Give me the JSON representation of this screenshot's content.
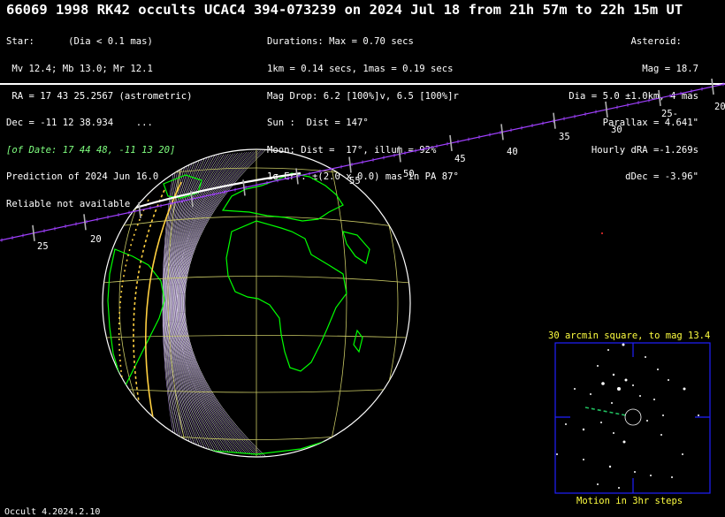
{
  "title": "66069 1998 RK42 occults UCAC4 394-073239 on 2024 Jul 18 from 21h 57m to 22h 15m UT",
  "star_info": [
    "Star:      (Dia < 0.1 mas)",
    " Mv 12.4; Mb 13.0; Mr 12.1",
    " RA = 17 43 25.2567 (astrometric)",
    "Dec = -11 12 38.934    ...",
    "[of Date: 17 44 48, -11 13 20]",
    "Prediction of 2024 Jun 16.0",
    "Reliable not available"
  ],
  "event_info": [
    "Durations: Max = 0.70 secs",
    "1km = 0.14 secs, 1mas = 0.19 secs",
    "Mag Drop: 6.2 [100%]v, 6.5 [100%]r",
    "Sun :  Dist = 147°",
    "Moon: Dist =  17°, illum = 92%",
    "1σ Err: ±(2.0 x 0.0) mas in PA 87°"
  ],
  "asteroid_info": [
    "Asteroid:   ",
    "Mag = 18.7",
    "Dia = 5.0 ±1.0km, 4 mas",
    "Parallax = 4.641\"",
    "Hourly dRA =-1.269s",
    "dDec = -3.96\""
  ],
  "track_labels": [
    "25",
    "20",
    "55",
    "50",
    "45",
    "40",
    "35",
    "30",
    "25-",
    "20"
  ],
  "finder": {
    "title": "30 arcmin square, to mag 13.4",
    "footer": "Motion in 3hr steps"
  },
  "version": "Occult 4.2024.2.10",
  "colors": {
    "background": "#000000",
    "coast": "#00ff00",
    "grid": "#c8c864",
    "track": "#a040ff",
    "limb": "#ffd040",
    "finder_frame": "#2020ff",
    "finder_text": "#ffff40"
  }
}
